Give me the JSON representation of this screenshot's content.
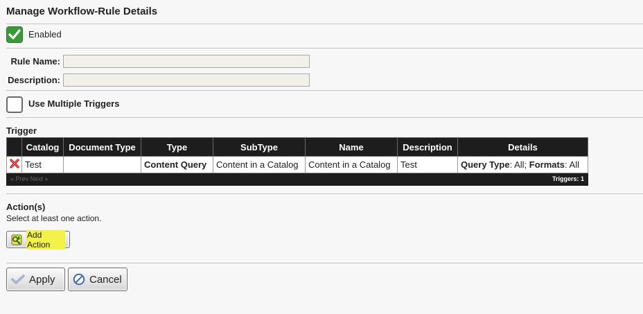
{
  "page": {
    "title": "Manage Workflow-Rule Details"
  },
  "enabled": {
    "label": "Enabled",
    "checked": true
  },
  "form": {
    "rule_name_label": "Rule Name:",
    "rule_name_value": "",
    "description_label": "Description:",
    "description_value": ""
  },
  "multi_trigger": {
    "label": "Use Multiple Triggers",
    "checked": false
  },
  "trigger": {
    "heading": "Trigger",
    "columns": [
      "Catalog",
      "Document Type",
      "Type",
      "SubType",
      "Name",
      "Description",
      "Details"
    ],
    "rows": [
      {
        "catalog": "Test",
        "document_type": "",
        "type": "Content Query",
        "subtype": "Content in a Catalog",
        "name": "Content in a Catalog",
        "description": "Test",
        "details": {
          "query_type_label": "Query Type",
          "query_type_value": ": All; ",
          "formats_label": "Formats",
          "formats_value": ": All"
        }
      }
    ],
    "pager": "« Prev Next »",
    "count": "Triggers: 1"
  },
  "actions": {
    "heading": "Action(s)",
    "hint": "Select at least one action.",
    "add_label": "Add Action"
  },
  "buttons": {
    "apply": "Apply",
    "cancel": "Cancel"
  },
  "colors": {
    "accent_green": "#3a9a3a",
    "header_dark": "#1d1d1d",
    "highlight": "#f2f24a",
    "delete_red": "#cc2222"
  }
}
